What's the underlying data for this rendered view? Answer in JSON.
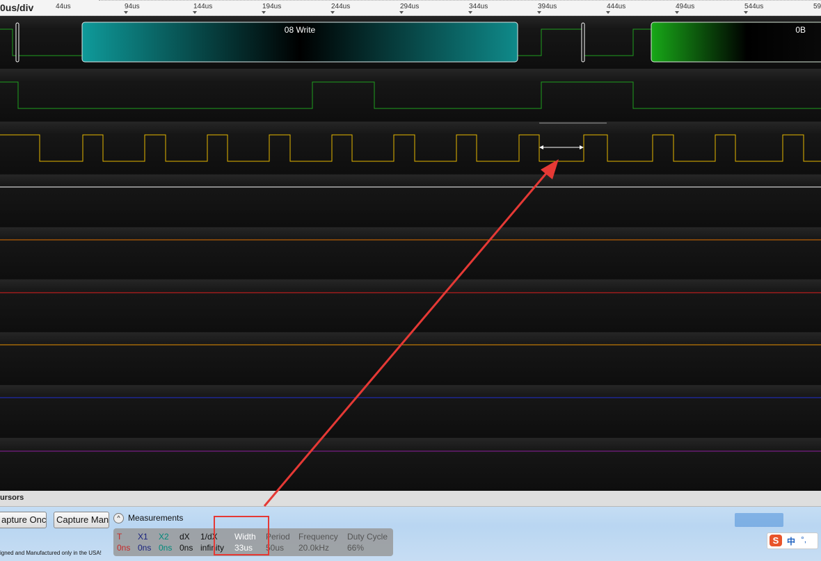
{
  "ruler": {
    "scale_label": "0us/div",
    "ticks": [
      "44us",
      "94us",
      "144us",
      "194us",
      "244us",
      "294us",
      "344us",
      "394us",
      "444us",
      "494us",
      "544us",
      "59"
    ]
  },
  "decoder": {
    "frame1_label": "08 Write",
    "frame2_label": "0B"
  },
  "cursors": {
    "label": "ursors"
  },
  "buttons": {
    "capture_once": "apture Once",
    "capture_manual": "Capture Man"
  },
  "measurements": {
    "title": "Measurements",
    "columns": [
      {
        "label": "T",
        "value": "0ns",
        "color": "#c62828"
      },
      {
        "label": "X1",
        "value": "0ns",
        "color": "#1a237e"
      },
      {
        "label": "X2",
        "value": "0ns",
        "color": "#00897b"
      },
      {
        "label": "dX",
        "value": "0ns",
        "color": "#111111"
      },
      {
        "label": "1/dX",
        "value": "infinity",
        "color": "#111111"
      },
      {
        "label": "Width",
        "value": "33us",
        "color": "#ffffff"
      },
      {
        "label": "Period",
        "value": "50us",
        "color": "#555555"
      },
      {
        "label": "Frequency",
        "value": "20.0kHz",
        "color": "#555555"
      },
      {
        "label": "Duty Cycle",
        "value": "66%",
        "color": "#555555"
      }
    ]
  },
  "footer": {
    "note": "igned and Manufactured only in the USA!"
  },
  "ime": {
    "logo": "S",
    "lang": "中",
    "punct": "°,"
  },
  "colors": {
    "channel_green": "#1fa01f",
    "channel_yellow": "#e6b800",
    "channel_white": "#ffffff",
    "channel_orange": "#e07000",
    "channel_red": "#e02020",
    "channel_orange2": "#e89000",
    "channel_blue": "#2030d0",
    "channel_purple": "#9020a0",
    "annotation_red": "#e53935"
  }
}
